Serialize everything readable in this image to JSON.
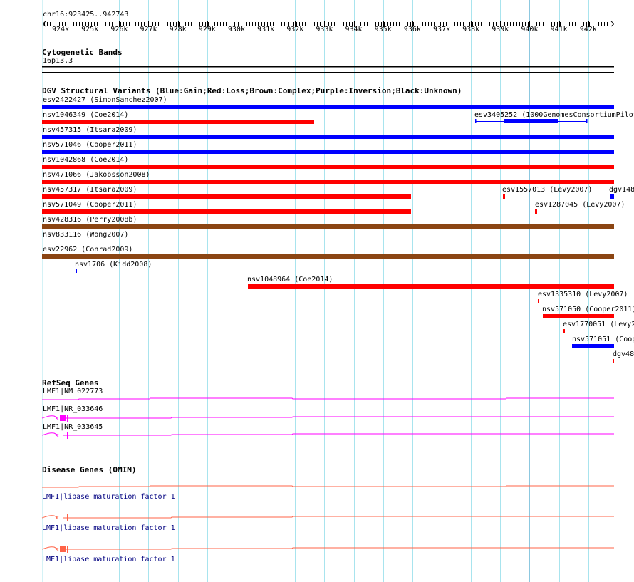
{
  "ruler": {
    "location": "chr16:923425..942743",
    "ticks": [
      "924k",
      "925k",
      "926k",
      "927k",
      "928k",
      "929k",
      "930k",
      "931k",
      "932k",
      "933k",
      "934k",
      "935k",
      "936k",
      "937k",
      "938k",
      "939k",
      "940k",
      "941k",
      "942k"
    ]
  },
  "cytoband": {
    "title": "Cytogenetic Bands",
    "band": "16p13.3"
  },
  "dgv": {
    "title": "DGV Structural Variants (Blue:Gain;Red:Loss;Brown:Complex;Purple:Inversion;Black:Unknown)",
    "colors": {
      "gain": "#0000ff",
      "loss": "#ff0000",
      "complex": "#8b4513"
    },
    "variants": [
      {
        "label": "esv2422427 (SimonSanchez2007)",
        "type": "gain"
      },
      {
        "label": "nsv1046349 (Coe2014)",
        "type": "loss"
      },
      {
        "label": "esv3405252 (1000GenomesConsortiumPilot",
        "type": "gain"
      },
      {
        "label": "nsv457315 (Itsara2009)",
        "type": "gain"
      },
      {
        "label": "nsv571046 (Cooper2011)",
        "type": "gain"
      },
      {
        "label": "nsv1042868 (Coe2014)",
        "type": "loss"
      },
      {
        "label": "nsv471066 (Jakobsson2008)",
        "type": "loss"
      },
      {
        "label": "nsv457317 (Itsara2009)",
        "type": "loss"
      },
      {
        "label": "esv1557013 (Levy2007)",
        "type": "loss"
      },
      {
        "label": "dgv148",
        "type": "gain"
      },
      {
        "label": "nsv571049 (Cooper2011)",
        "type": "loss"
      },
      {
        "label": "esv1287045 (Levy2007)",
        "type": "loss"
      },
      {
        "label": "nsv428316 (Perry2008b)",
        "type": "complex"
      },
      {
        "label": "nsv833116 (Wong2007)",
        "type": "loss"
      },
      {
        "label": "esv22962 (Conrad2009)",
        "type": "complex"
      },
      {
        "label": "nsv1706 (Kidd2008)",
        "type": "gain"
      },
      {
        "label": "nsv1048964 (Coe2014)",
        "type": "loss"
      },
      {
        "label": "esv1335310 (Levy2007)",
        "type": "loss"
      },
      {
        "label": "nsv571050 (Cooper2011)",
        "type": "loss"
      },
      {
        "label": "esv1770051 (Levy2",
        "type": "loss"
      },
      {
        "label": "nsv571051 (Coop",
        "type": "gain"
      },
      {
        "label": "dgv48",
        "type": "loss"
      }
    ]
  },
  "refseq": {
    "title": "RefSeq Genes",
    "color": "#ff00ff",
    "genes": [
      "LMF1|NM_022773",
      "LMF1|NR_033646",
      "LMF1|NR_033645"
    ]
  },
  "omim": {
    "title": "Disease Genes (OMIM)",
    "color": "#ff6347",
    "genes": [
      "LMF1|lipase maturation factor 1",
      "LMF1|lipase maturation factor 1",
      "LMF1|lipase maturation factor 1"
    ]
  }
}
